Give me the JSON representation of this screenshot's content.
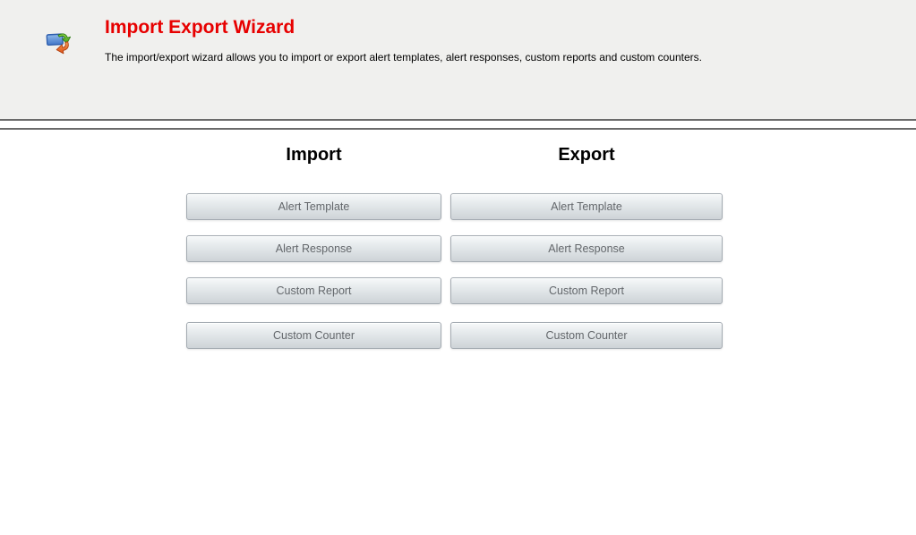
{
  "header": {
    "title": "Import Export Wizard",
    "description": "The import/export wizard allows you to import or export alert templates, alert responses, custom reports and custom counters.",
    "icon": "import-export-icon",
    "title_color": "#e70000",
    "background_color": "#f0f0ee",
    "divider_color": "#6a6a6a"
  },
  "columns": [
    {
      "id": "import",
      "heading": "Import",
      "buttons": [
        {
          "label": "Alert Template"
        },
        {
          "label": "Alert Response"
        },
        {
          "label": "Custom Report"
        },
        {
          "label": "Custom Counter"
        }
      ]
    },
    {
      "id": "export",
      "heading": "Export",
      "buttons": [
        {
          "label": "Alert Template"
        },
        {
          "label": "Alert Response"
        },
        {
          "label": "Custom Report"
        },
        {
          "label": "Custom Counter"
        }
      ]
    }
  ],
  "button_style": {
    "text_color": "#63676b",
    "border_color": "#a3aab1",
    "gradient_top": "#f7f9fa",
    "gradient_bottom": "#ced3d7"
  }
}
